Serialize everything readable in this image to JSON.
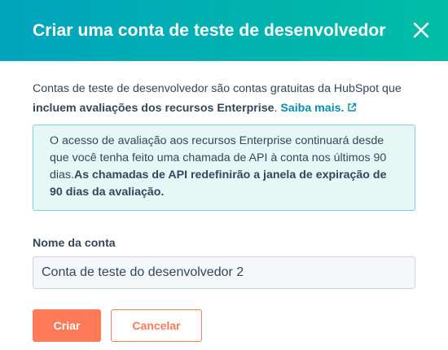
{
  "dialog": {
    "title": "Criar uma conta de teste de desenvolvedor",
    "close_icon": "close-icon"
  },
  "intro": {
    "text_part1": "Contas de teste de desenvolvedor são contas gratuitas da HubSpot que ",
    "text_bold": "incluem avaliações dos recursos Enterprise",
    "text_part2": ". ",
    "link_label": "Saiba mais.",
    "link_icon": "external-link-icon"
  },
  "alert": {
    "text": "O acesso de avaliação aos recursos Enterprise continuará desde que você tenha feito uma chamada de API à conta nos últimos 90 dias.",
    "text_bold": "As chamadas de API redefinirão a janela de expiração de 90 dias da avaliação."
  },
  "account_name": {
    "label": "Nome da conta",
    "value": "Conta de teste do desenvolvedor 2"
  },
  "actions": {
    "create_label": "Criar",
    "cancel_label": "Cancelar"
  },
  "colors": {
    "header_gradient_start": "#00a4bd",
    "header_gradient_end": "#00bda5",
    "primary": "#ff7a59",
    "link": "#0091ae",
    "text": "#33475b",
    "alert_bg": "#e5f8f6",
    "alert_border": "#7fd1de"
  }
}
